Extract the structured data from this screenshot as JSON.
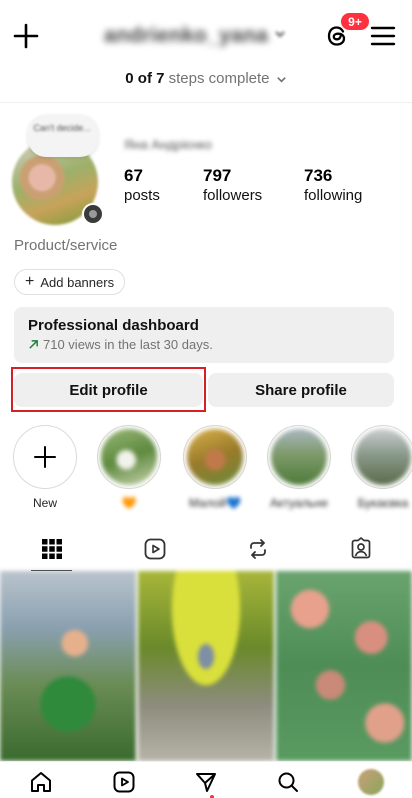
{
  "header": {
    "create_icon": "plus-icon",
    "username": "andrienko_yana",
    "threads_icon": "threads-icon",
    "notification_badge": "9+",
    "menu_icon": "hamburger-menu-icon"
  },
  "steps": {
    "count": "0 of 7",
    "text": "steps complete"
  },
  "profile": {
    "note": "Can't decide...",
    "full_name": "Яна Андрієнко",
    "posts_count": "67",
    "posts_label": "posts",
    "followers_count": "797",
    "followers_label": "followers",
    "following_count": "736",
    "following_label": "following",
    "category": "Product/service"
  },
  "banners": {
    "label": "Add banners"
  },
  "dashboard": {
    "title": "Professional dashboard",
    "subtitle": "710 views in the last 30 days."
  },
  "buttons": {
    "edit_profile": "Edit profile",
    "share_profile": "Share profile"
  },
  "highlights": [
    {
      "label": "New"
    },
    {
      "label": "🧡"
    },
    {
      "label": "Малой💙"
    },
    {
      "label": "Актуальне"
    },
    {
      "label": "Букаєвка"
    }
  ],
  "tabs": [
    "grid-icon",
    "reels-icon",
    "reposts-icon",
    "tagged-icon"
  ],
  "bottom_nav": [
    "home-icon",
    "reels-icon",
    "messages-icon",
    "search-icon",
    "profile-avatar"
  ],
  "colors": {
    "badge": "#ff3040",
    "highlight_outline": "#d61f26",
    "trend_arrow": "#1a7f37",
    "button_bg": "#efefef"
  }
}
